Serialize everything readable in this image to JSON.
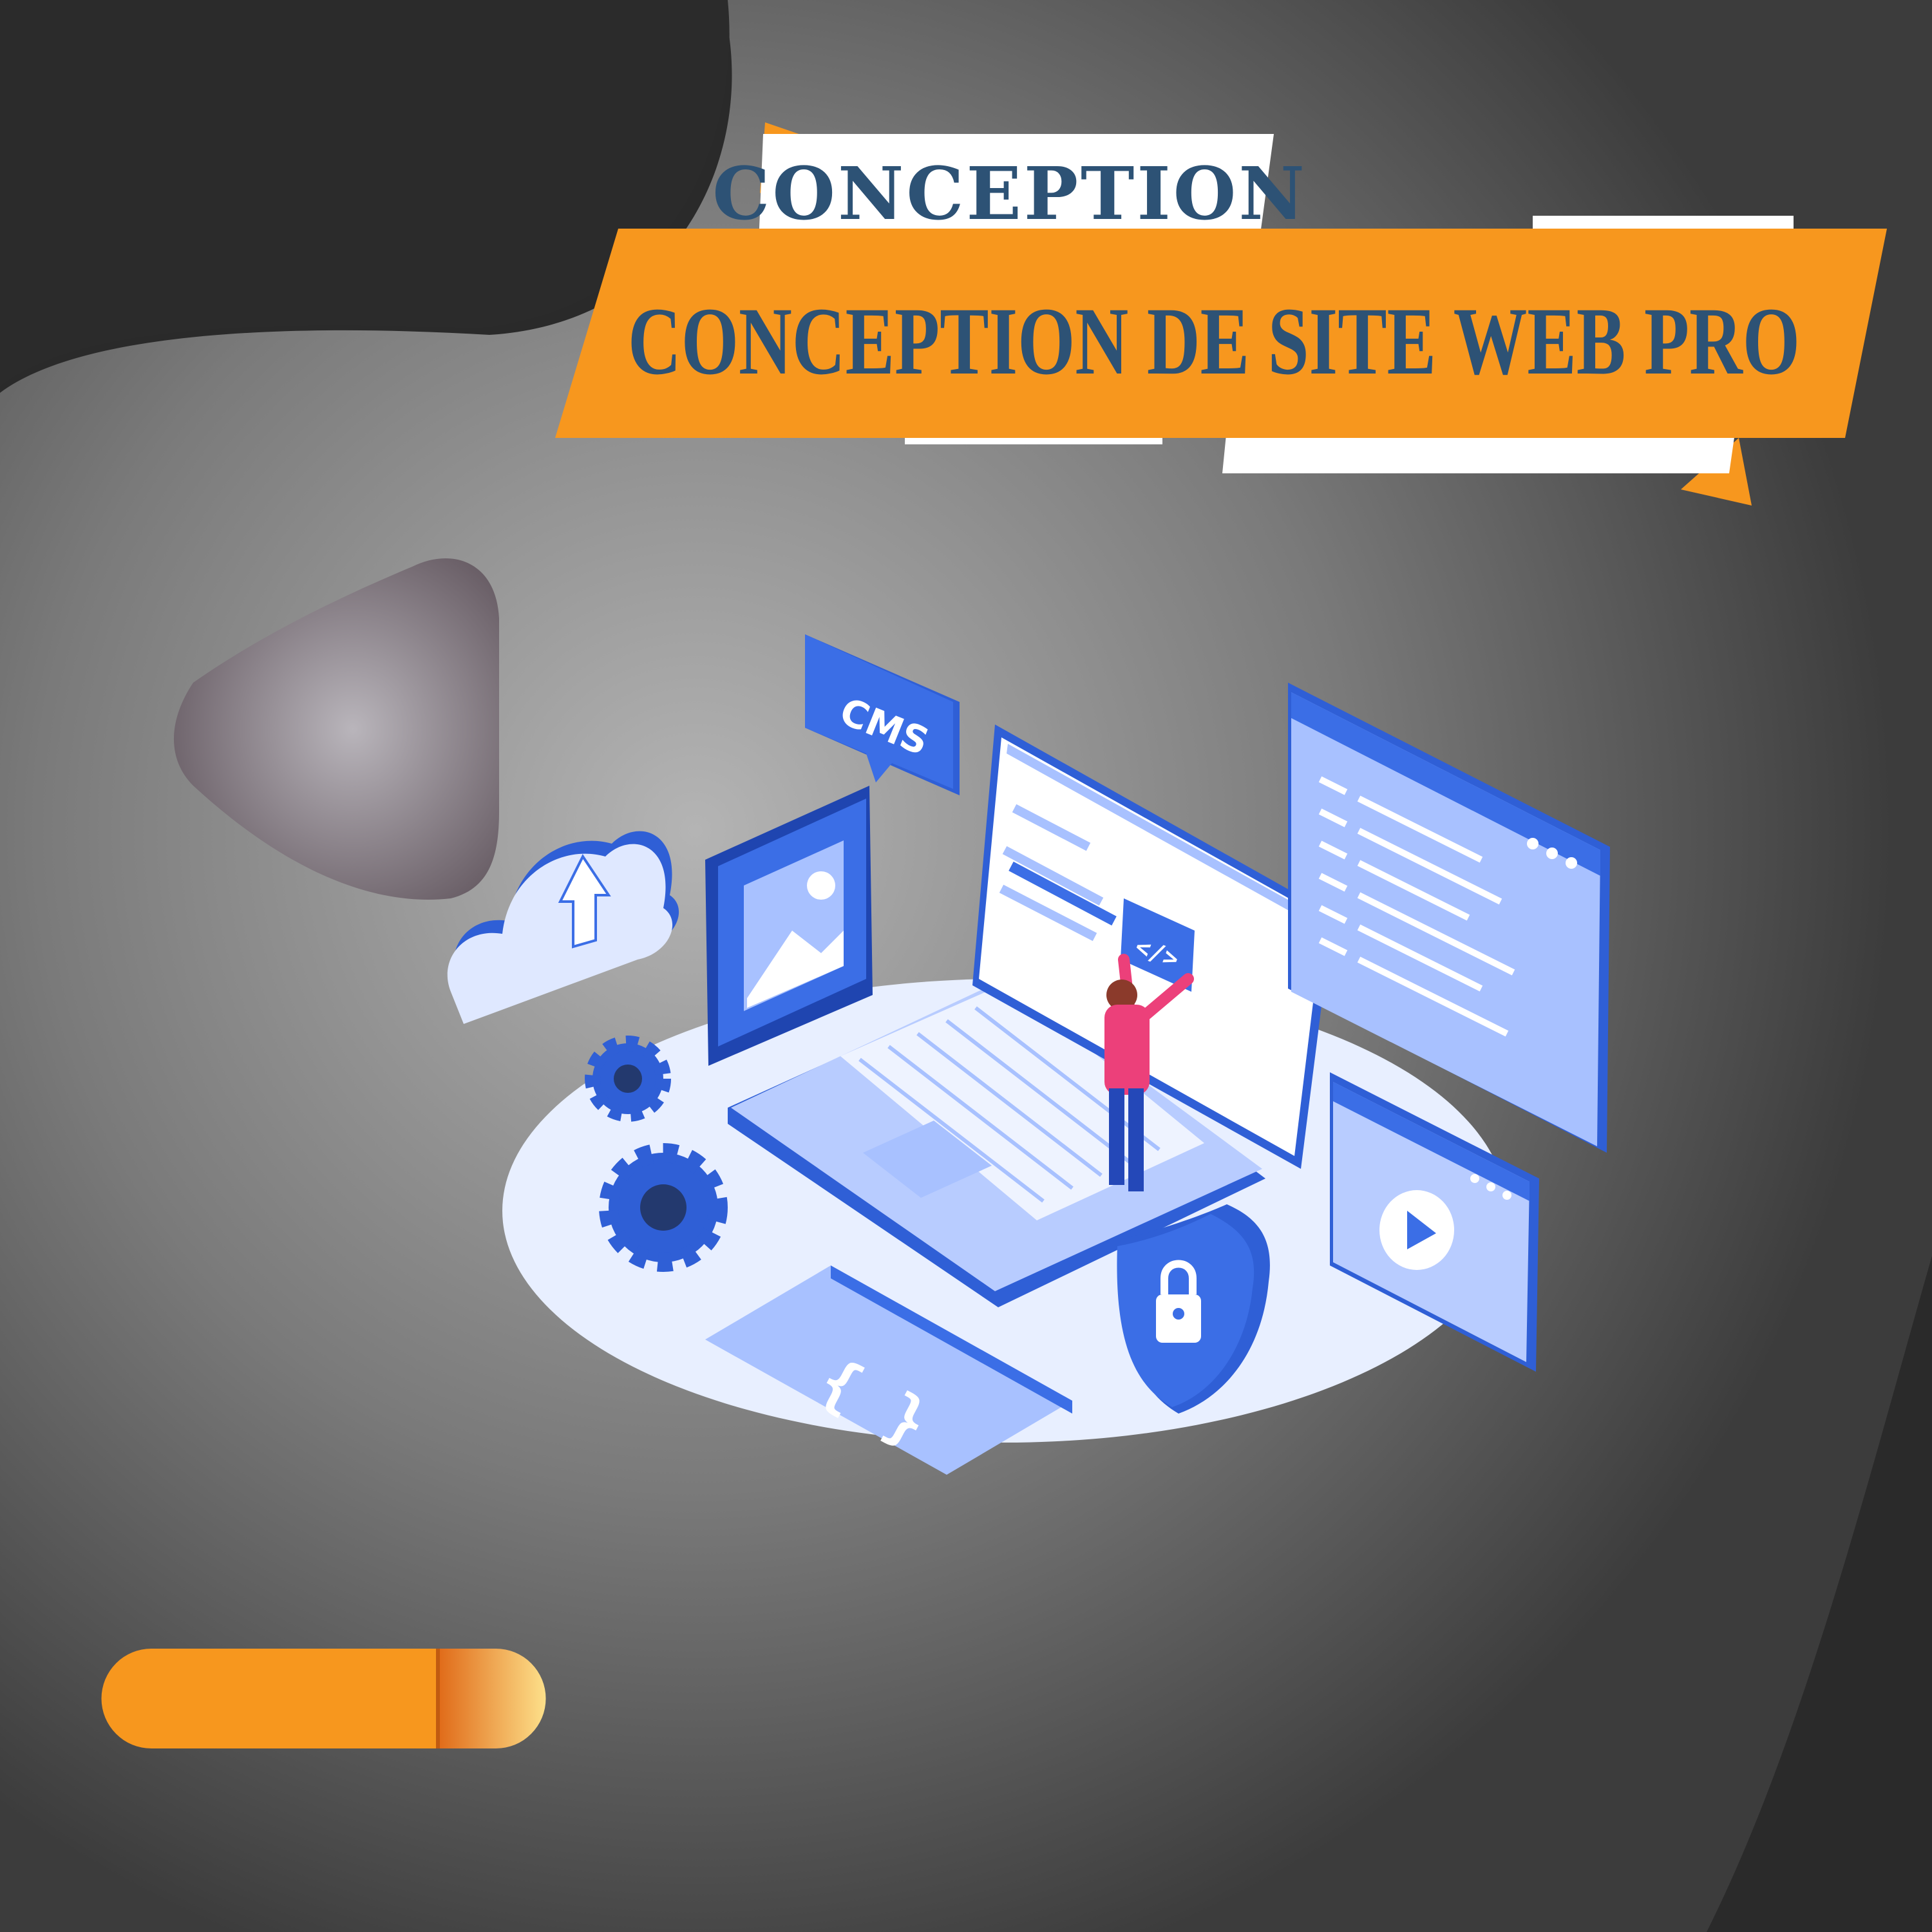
{
  "banner": {
    "top_word": "CONCEPTION",
    "main_title": "CONCEPTION DE SITE WEB PRO"
  },
  "illustration": {
    "cms_bubble": "CMS",
    "code_tile": "</>",
    "braces": "{ }",
    "icons": [
      "cloud-upload-icon",
      "image-icon",
      "gear-icon",
      "padlock-shield-icon",
      "video-play-icon",
      "code-icon",
      "browser-window-icon"
    ]
  },
  "colors": {
    "background_dark": "#2a2a2a",
    "background_gray": "#9a9a9a",
    "accent_orange": "#f7971e",
    "title_blue": "#2d5275",
    "illustration_blue": "#3b6ee6",
    "illustration_light_blue": "#a8c1ff",
    "person_pink": "#ec407a"
  }
}
